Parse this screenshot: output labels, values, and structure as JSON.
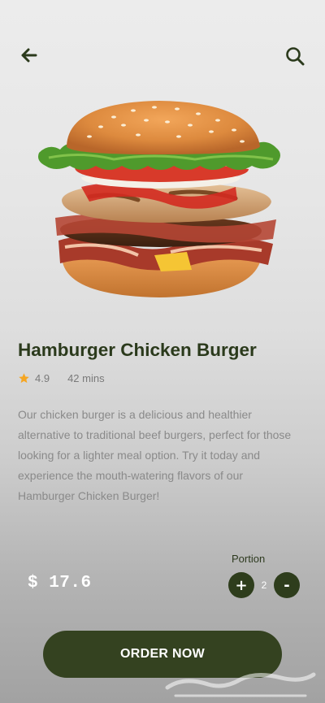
{
  "nav": {
    "back_icon": "arrow-left-icon",
    "search_icon": "search-icon"
  },
  "product": {
    "image_icon": "burger-image",
    "name": "Hamburger Chicken Burger",
    "rating": "4.9",
    "time": "42 mins",
    "description": "Our chicken burger is a delicious and healthier alternative to traditional beef burgers, perfect for those looking for a lighter meal option. Try it today and experience the mouth-watering flavors of our Hamburger Chicken Burger!"
  },
  "order": {
    "portion_label": "Portion",
    "price": "$ 17.6",
    "quantity": "2",
    "increment_label": "+",
    "decrement_label": "-",
    "button_label": "ORDER NOW"
  },
  "colors": {
    "accent": "#344220",
    "star": "#f5a623",
    "text_dark": "#2b3a1c",
    "text_muted": "#8a8a8a"
  }
}
